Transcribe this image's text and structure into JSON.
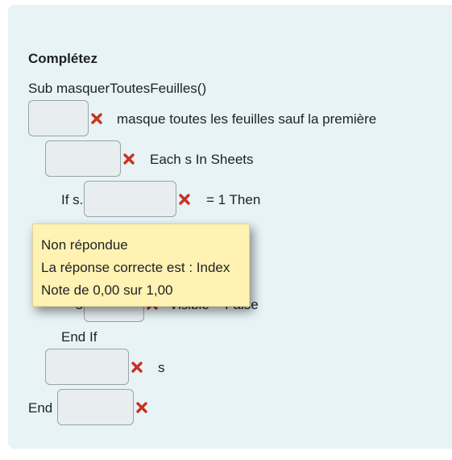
{
  "question": {
    "title": "Complétez",
    "lines": {
      "sub_header": "Sub masquerToutesFeuilles()",
      "line1_text": "masque toutes les feuilles sauf la première",
      "line2_text": "Each s In Sheets",
      "line3_prefix": "If s.",
      "line3_suffix": "= 1 Then",
      "line4_prefix": "s",
      "line4_suffix": "Visible = False",
      "end_if": "End If",
      "line6_text": "s",
      "end_prefix": "End"
    }
  },
  "tooltip": {
    "status": "Non répondue",
    "correct_answer": "La réponse correcte est : Index",
    "grade": "Note de 0,00 sur 1,00"
  },
  "icons": {
    "incorrect": "cross-icon",
    "incorrect_color": "#ca3120"
  }
}
